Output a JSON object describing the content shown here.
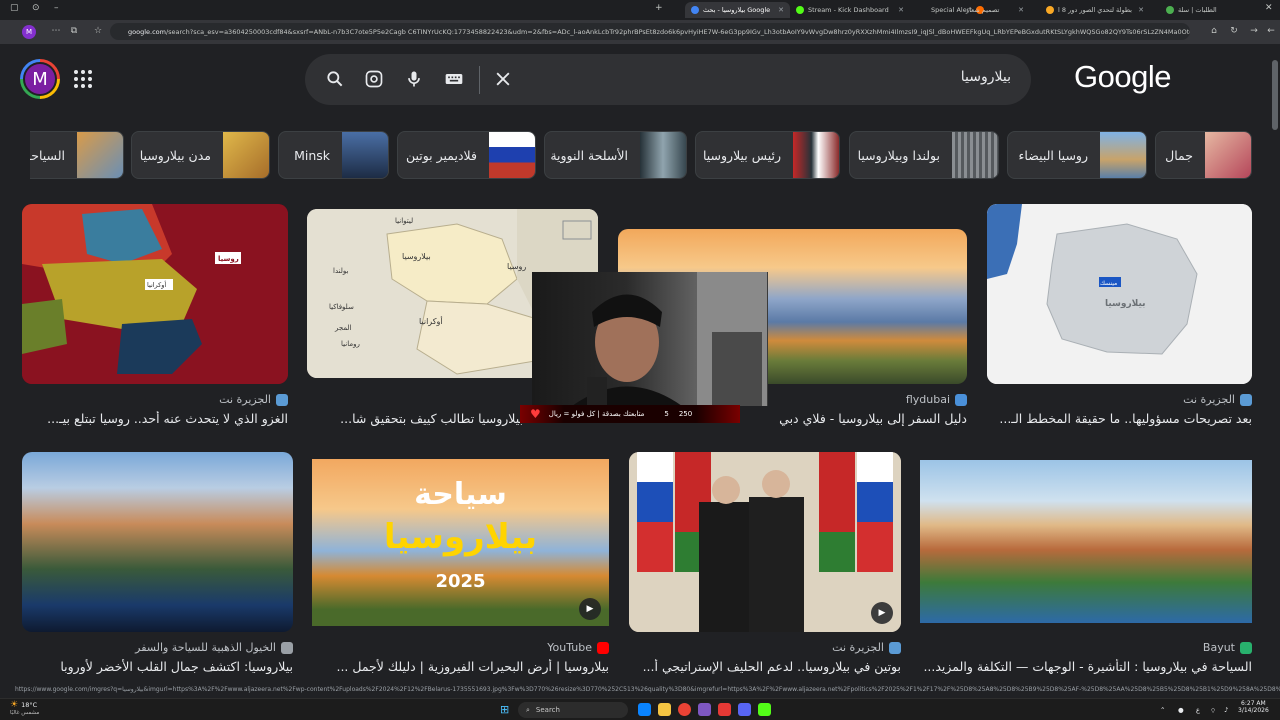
{
  "browser": {
    "tabs": [
      {
        "label": "الطلبات | سلة",
        "color": "#4caf50"
      },
      {
        "label": "بطولة لتحدي الصور دور 8 ا",
        "color": "#f9a825"
      },
      {
        "label": "تصميم شعار",
        "color": "#f5f5f5"
      },
      {
        "label": "Special Alert",
        "color": "#ff6d00"
      },
      {
        "label": "Stream - Kick Dashboard",
        "color": "#53fc18"
      },
      {
        "label": "بيلاروسيا - بحث Google",
        "color": "#4285f4",
        "active": true
      }
    ],
    "url_host": "google.com",
    "url_rest": "/search?sca_esv=a3604250003cdf84&sxsrf=ANbL-n7b3C7ote5P5e2Cagb C6TINYrUcKQ:1773458822423&udm=2&fbs=ADc_l-aoAnkLcbTr92phrBPsEt8zdo6k6pvHyiHE7W-6eG3pp9IGv_Lh3otbAoIY9vWvgDw8hrz0yRXXzhMmi4IlmzsI9_iqJSl_dBoHWEEFkgUq_LRbYEPeBGxdutRKtSLYgkhWQSGo82QY9Ts06rSLzZN4Ma0Otdxk6n12km_D..."
  },
  "search": {
    "query": "بيلاروسيا",
    "logo": "Google",
    "avatar_letter": "M"
  },
  "chips": [
    {
      "label": "جمال",
      "color": "#b5465a"
    },
    {
      "label": "روسيا البيضاء",
      "color": "#5a7fa8"
    },
    {
      "label": "بولندا وبيلاروسيا",
      "color": "#6b6f73"
    },
    {
      "label": "رئيس بيلاروسيا",
      "color": "#8a2b2b"
    },
    {
      "label": "الأسلحة النووية",
      "color": "#4a5563"
    },
    {
      "label": "فلاديمير بوتين",
      "color": "#c0392b"
    },
    {
      "label": "Minsk",
      "color": "#3b5a7a"
    },
    {
      "label": "مدن بيلاروسيا",
      "color": "#a68a3c"
    },
    {
      "label": "السياحة",
      "color": "#b07a3a"
    }
  ],
  "results_row1": [
    {
      "source": "الجزيرة نت",
      "title": "بعد تصريحات مسؤوليها.. ما حقيقة المخطط الـ...",
      "icon_color": "#5b9bd5",
      "map_label": "بيلاروسيا"
    },
    {
      "source": "flydubai",
      "title": "دليل السفر إلى بيلاروسيا - فلاي دبي",
      "icon_color": "#4a90d9"
    },
    {
      "source": "",
      "title": "بيلاروسيا تطالب كييف بتحقيق شا...",
      "icon_color": "#5b9bd5",
      "map_labels": [
        "ليتوانيا",
        "بيلاروسيا",
        "بولندا",
        "روسيا",
        "أوكرانيا",
        "سلوفاكيا",
        "المجر",
        "رومانيا"
      ]
    },
    {
      "source": "الجزيرة نت",
      "title": "الغزو الذي لا يتحدث عنه أحد.. روسيا تبتلع بيـ...",
      "icon_color": "#5b9bd5",
      "map_labels": [
        "روسيا",
        "أوكرانيا"
      ]
    }
  ],
  "results_row2": [
    {
      "source": "Bayut",
      "title": "السياحة في بيلاروسيا : التأشيرة - الوجهات — التكلفة والمزيد...",
      "icon_color": "#28b16d"
    },
    {
      "source": "الجزيرة نت",
      "title": "بوتين في بيلاروسيا.. لدعم الحليف الإستراتيجي أ...",
      "icon_color": "#5b9bd5"
    },
    {
      "source": "YouTube",
      "title": "بيلاروسيا | أرض البحيرات الفيروزية | دليلك لأجمل ...",
      "icon_color": "#ff0000",
      "overlay_line1": "سياحة",
      "overlay_line2": "بيلاروسيا",
      "overlay_year": "2025"
    },
    {
      "source": "الخيول الذهبية للسياحة والسفر",
      "title": "بيلاروسيا: اكتشف جمال القلب الأخضر لأوروبا",
      "icon_color": "#9aa0a6"
    }
  ],
  "webcam": {
    "banner_left": "250",
    "banner_mid": "5",
    "banner_text": "متابعتك بصدقة | كل فولو = ريال"
  },
  "status_url": "https://www.google.com/imgres?q=بيلاروسيا&imgurl=https%3A%2F%2Fwww.aljazeera.net%2Fwp-content%2Fuploads%2F2024%2F12%2FBelarus-1735551693.jpg%3Fw%3D770%26resize%3D770%252C513%26quality%3D80&imgrefurl=https%3A%2F%2Fwww.aljazeera.net%2Fpolitics%2F2025%2F1%2F17%2F%25D8%25A8%25D8%25B9%25D8%25AF-%25D8%25AA%25D8%25B5%25D8%25B1%25D9%258A%25D8%25AD%25D8%25A7%25D8%25AA-%25D9%2585%25D8%25B3%25D8%25A4%25D9%2588",
  "taskbar": {
    "weather_temp": "18°C",
    "weather_desc": "مشمس غالبًا",
    "search_label": "Search",
    "time": "6:27 AM",
    "date": "3/14/2026",
    "lang": "ع"
  }
}
